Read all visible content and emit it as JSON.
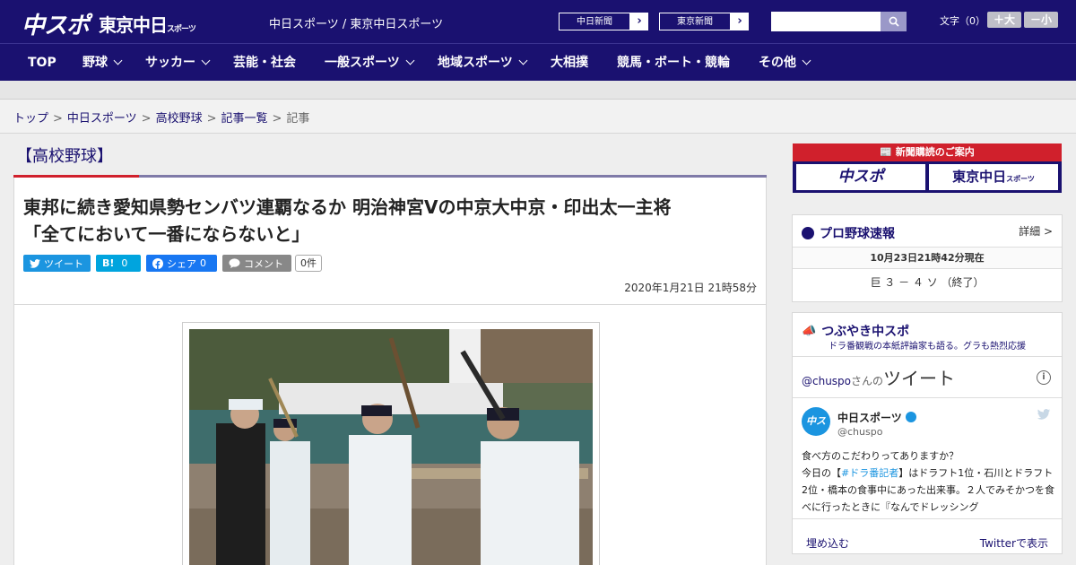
{
  "header": {
    "logo_primary": "中スポ",
    "logo_secondary": "東京中日",
    "logo_secondary_small": "スポーツ",
    "site_title": "中日スポーツ / 東京中日スポーツ",
    "ext_links": [
      {
        "label": "中日新聞"
      },
      {
        "label": "東京新聞"
      }
    ],
    "search_placeholder": "",
    "font_size_label": "文字（0）",
    "font_bigger": "＋大",
    "font_smaller": "－小"
  },
  "nav": {
    "items": [
      {
        "label": "TOP",
        "has_dropdown": false
      },
      {
        "label": "野球",
        "has_dropdown": true
      },
      {
        "label": "サッカー",
        "has_dropdown": true
      },
      {
        "label": "芸能・社会",
        "has_dropdown": false
      },
      {
        "label": "一般スポーツ",
        "has_dropdown": true
      },
      {
        "label": "地域スポーツ",
        "has_dropdown": true
      },
      {
        "label": "大相撲",
        "has_dropdown": false
      },
      {
        "label": "競馬・ボート・競輪",
        "has_dropdown": false
      },
      {
        "label": "その他",
        "has_dropdown": true
      }
    ]
  },
  "breadcrumb": {
    "items": [
      "トップ",
      "中日スポーツ",
      "高校野球",
      "記事一覧",
      "記事"
    ],
    "separator": ">"
  },
  "article": {
    "category": "【高校野球】",
    "headline_line1": "東邦に続き愛知県勢センバツ連覇なるか 明治神宮Vの中京大中京・印出太一主将",
    "headline_line2": "「全てにおいて一番にならないと」",
    "share": {
      "tweet": "ツイート",
      "hatena_label": "B!",
      "hatena_count": "0",
      "facebook": "シェア",
      "facebook_count": "0",
      "comment": "コメント",
      "comment_count": "0件"
    },
    "published": "2020年1月21日 21時58分"
  },
  "sidebar": {
    "promo": {
      "title": "新聞購読のご案内",
      "left": "中スポ",
      "right": "東京中日",
      "right_small": "スポーツ"
    },
    "baseball": {
      "title": "プロ野球速報",
      "detail": "詳細 >",
      "time": "10月23日21時42分現在",
      "score": "巨 ３ － ４ ソ （終了）"
    },
    "twitter": {
      "title": "つぶやき中スポ",
      "subtitle": "ドラ番観戦の本紙評論家も語る。グラも熱烈応援",
      "handle_prefix": "@chuspo",
      "handle_suffix": "さんの",
      "tweets_word": "ツイート",
      "info": "i",
      "tweet": {
        "avatar_text": "中スポ",
        "name": "中日スポーツ",
        "handle": "@chuspo",
        "line1": "食べ方のこだわりってありますか？",
        "line2_pre": "今日の【",
        "line2_hashtag": "#ドラ番記者",
        "line2_post": "】はドラフト1位・石川とドラフト2位・橋本の食事中にあった出来事。２人でみそかつを食べに行ったときに『なんでドレッシング"
      },
      "embed": "埋め込む",
      "view_on_twitter": "Twitterで表示"
    }
  },
  "colors": {
    "brand_navy": "#1a1170",
    "accent_red": "#d0202c",
    "twitter_blue": "#1b95e0"
  }
}
